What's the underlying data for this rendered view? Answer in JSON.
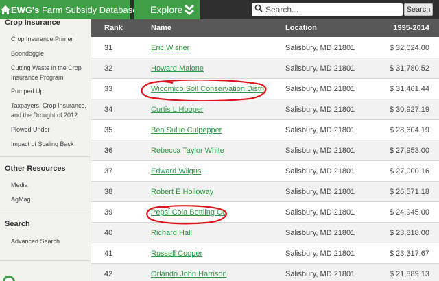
{
  "topbar": {
    "brand_bold": "EWG's",
    "brand_rest": " Farm Subsidy Database",
    "explore_label": "Explore",
    "search_placeholder": "Search...",
    "search_button": "Search",
    "colors": {
      "brand_green": "#3f9f47",
      "bar": "#2f2f2f"
    }
  },
  "sidebar": {
    "sections": [
      {
        "title": "Crop Insurance",
        "items": [
          "Crop Insurance Primer",
          "Boondoggle",
          "Cutting Waste in the Crop Insurance Program",
          "Pumped Up",
          "Taxpayers, Crop Insurance, and the Drought of 2012",
          "Plowed Under",
          "Impact of Scaling Back"
        ]
      },
      {
        "title": "Other Resources",
        "items": [
          "Media",
          "AgMag"
        ]
      },
      {
        "title": "Search",
        "items": [
          "Advanced Search"
        ]
      }
    ]
  },
  "table": {
    "headers": [
      "Rank",
      "Name",
      "Location",
      "1995-2014"
    ],
    "rows": [
      {
        "rank": "31",
        "name": "Eric Wisner",
        "location": "Salisbury, MD 21801",
        "amount": "$ 32,024.00"
      },
      {
        "rank": "32",
        "name": "Howard Malone",
        "location": "Salisbury, MD 21801",
        "amount": "$ 31,780.52"
      },
      {
        "rank": "33",
        "name": "Wicomico Soil Conservation Distri",
        "location": "Salisbury, MD 21801",
        "amount": "$ 31,461.44"
      },
      {
        "rank": "34",
        "name": "Curtis L Hooper",
        "location": "Salisbury, MD 21801",
        "amount": "$ 30,927.19"
      },
      {
        "rank": "35",
        "name": "Ben Sullie Culpepper",
        "location": "Salisbury, MD 21801",
        "amount": "$ 28,604.19"
      },
      {
        "rank": "36",
        "name": "Rebecca Taylor White",
        "location": "Salisbury, MD 21801",
        "amount": "$ 27,953.00"
      },
      {
        "rank": "37",
        "name": "Edward Wilgus",
        "location": "Salisbury, MD 21801",
        "amount": "$ 27,000.16"
      },
      {
        "rank": "38",
        "name": "Robert E Holloway",
        "location": "Salisbury, MD 21801",
        "amount": "$ 26,571.18"
      },
      {
        "rank": "39",
        "name": "Pepsi Cola Bottling Co",
        "location": "Salisbury, MD 21801",
        "amount": "$ 24,945.00"
      },
      {
        "rank": "40",
        "name": "Richard Hall",
        "location": "Salisbury, MD 21801",
        "amount": "$ 23,818.00"
      },
      {
        "rank": "41",
        "name": "Russell Cooper",
        "location": "Salisbury, MD 21801",
        "amount": "$ 23,317.67"
      },
      {
        "rank": "42",
        "name": "Orlando John Harrison",
        "location": "Salisbury, MD 21801",
        "amount": "$ 21,889.13"
      }
    ],
    "colors": {
      "header_bg": "#585858",
      "link": "#2e9a45"
    }
  },
  "annotations": {
    "circled_ranks": [
      "33",
      "39"
    ],
    "color": "#e0141c"
  }
}
